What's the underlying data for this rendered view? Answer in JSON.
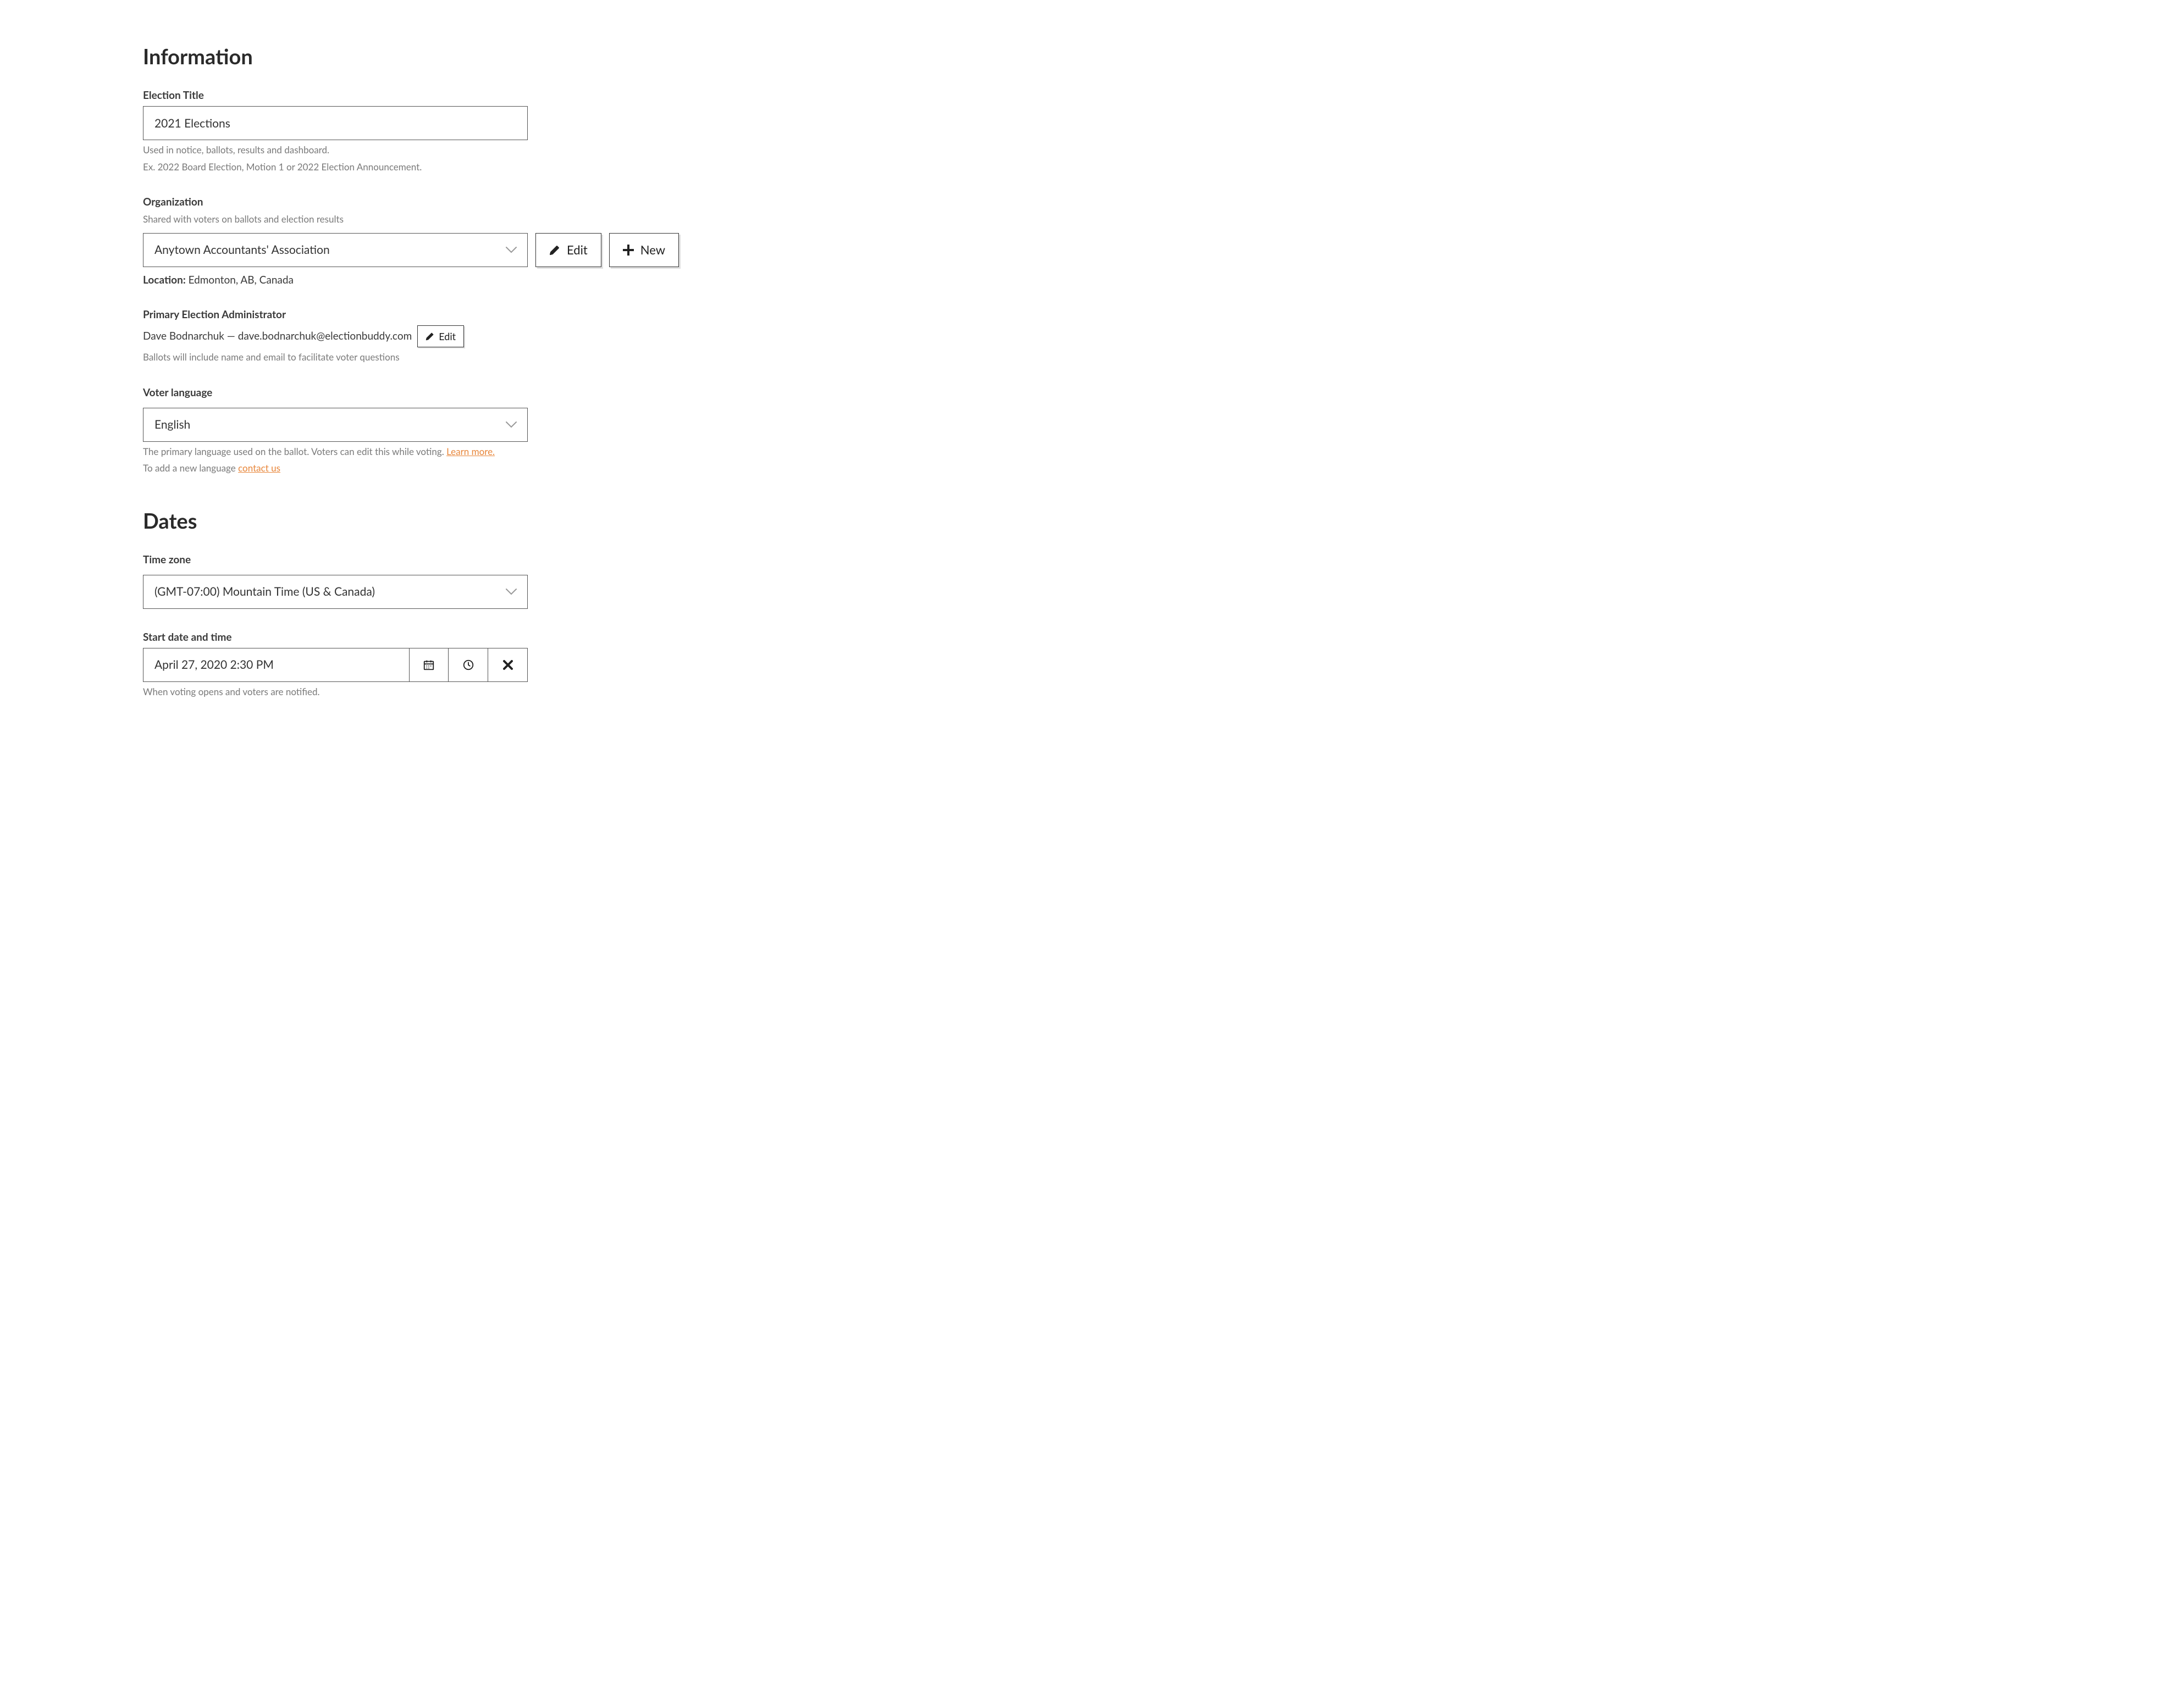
{
  "sections": {
    "information": {
      "heading": "Information",
      "election_title": {
        "label": "Election Title",
        "value": "2021 Elections",
        "help1": "Used in notice, ballots, results and dashboard.",
        "help2": "Ex. 2022 Board Election, Motion 1 or 2022 Election Announcement."
      },
      "organization": {
        "label": "Organization",
        "sub": "Shared with voters on ballots and election results",
        "value": "Anytown Accountants' Association",
        "edit_label": "Edit",
        "new_label": "New",
        "location_label": "Location:",
        "location_value": "Edmonton, AB, Canada"
      },
      "admin": {
        "label": "Primary Election Administrator",
        "value": "Dave Bodnarchuk — dave.bodnarchuk@electionbuddy.com",
        "edit_label": "Edit",
        "help": "Ballots will include name and email to facilitate voter questions"
      },
      "language": {
        "label": "Voter language",
        "value": "English",
        "help1_a": "The primary language used on the ballot. Voters can edit this while voting. ",
        "help1_link": "Learn more.",
        "help2_a": "To add a new language ",
        "help2_link": "contact us"
      }
    },
    "dates": {
      "heading": "Dates",
      "timezone": {
        "label": "Time zone",
        "value": "(GMT-07:00) Mountain Time (US & Canada)"
      },
      "start": {
        "label": "Start date and time",
        "value": "April 27, 2020 2:30 PM",
        "help": "When voting opens and voters are notified."
      }
    }
  }
}
